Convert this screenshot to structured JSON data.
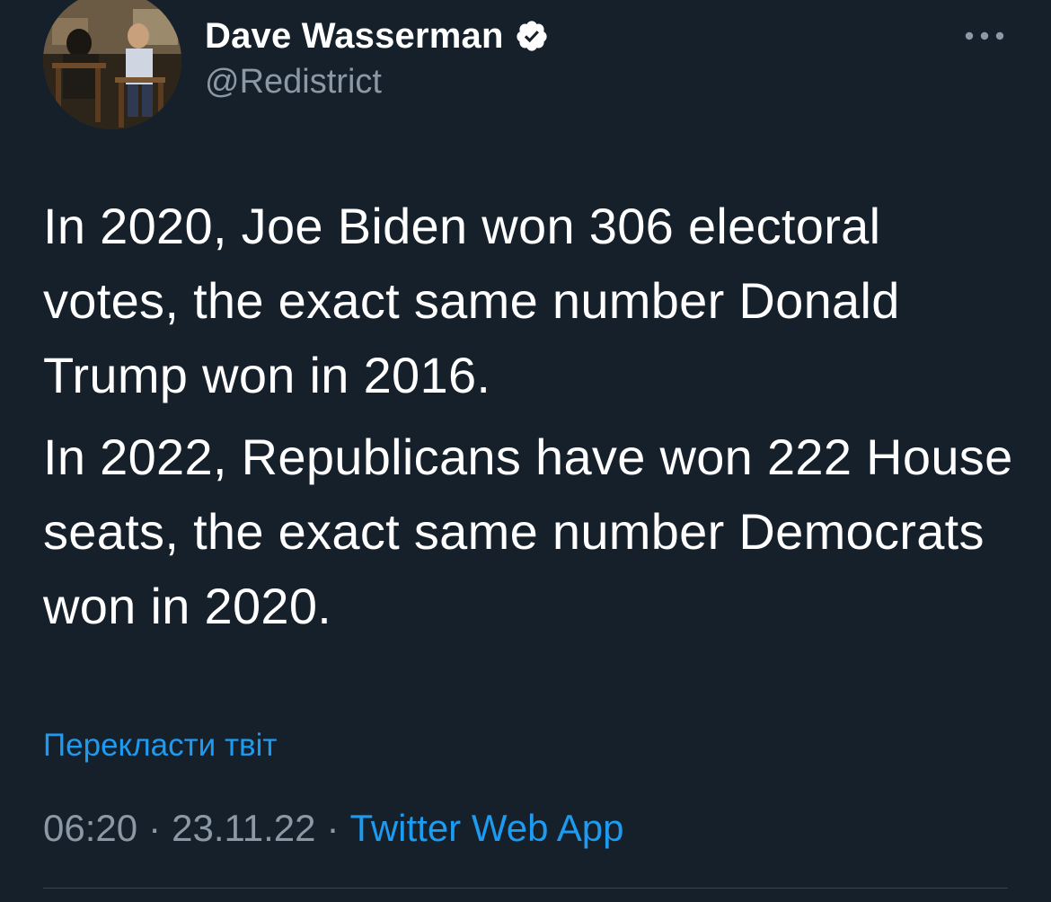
{
  "theme": {
    "background": "#15202b",
    "text_primary": "#ffffff",
    "text_secondary": "#8b98a5",
    "accent": "#1d9bf0",
    "divider": "#38444d"
  },
  "author": {
    "display_name": "Dave Wasserman",
    "handle": "@Redistrict",
    "verified_icon": "verified-badge-icon",
    "avatar": "profile-photo"
  },
  "more_menu": {
    "icon": "more-horizontal-icon"
  },
  "tweet": {
    "paragraphs": [
      "In 2020, Joe Biden won 306 electoral votes, the exact same number Donald Trump won in 2016.",
      "In 2022, Republicans have won 222 House seats, the exact same number Democrats won in 2020."
    ],
    "translate_label": "Перекласти твіт"
  },
  "meta": {
    "time": "06:20",
    "separator": "·",
    "date": "23.11.22",
    "source": "Twitter Web App"
  }
}
